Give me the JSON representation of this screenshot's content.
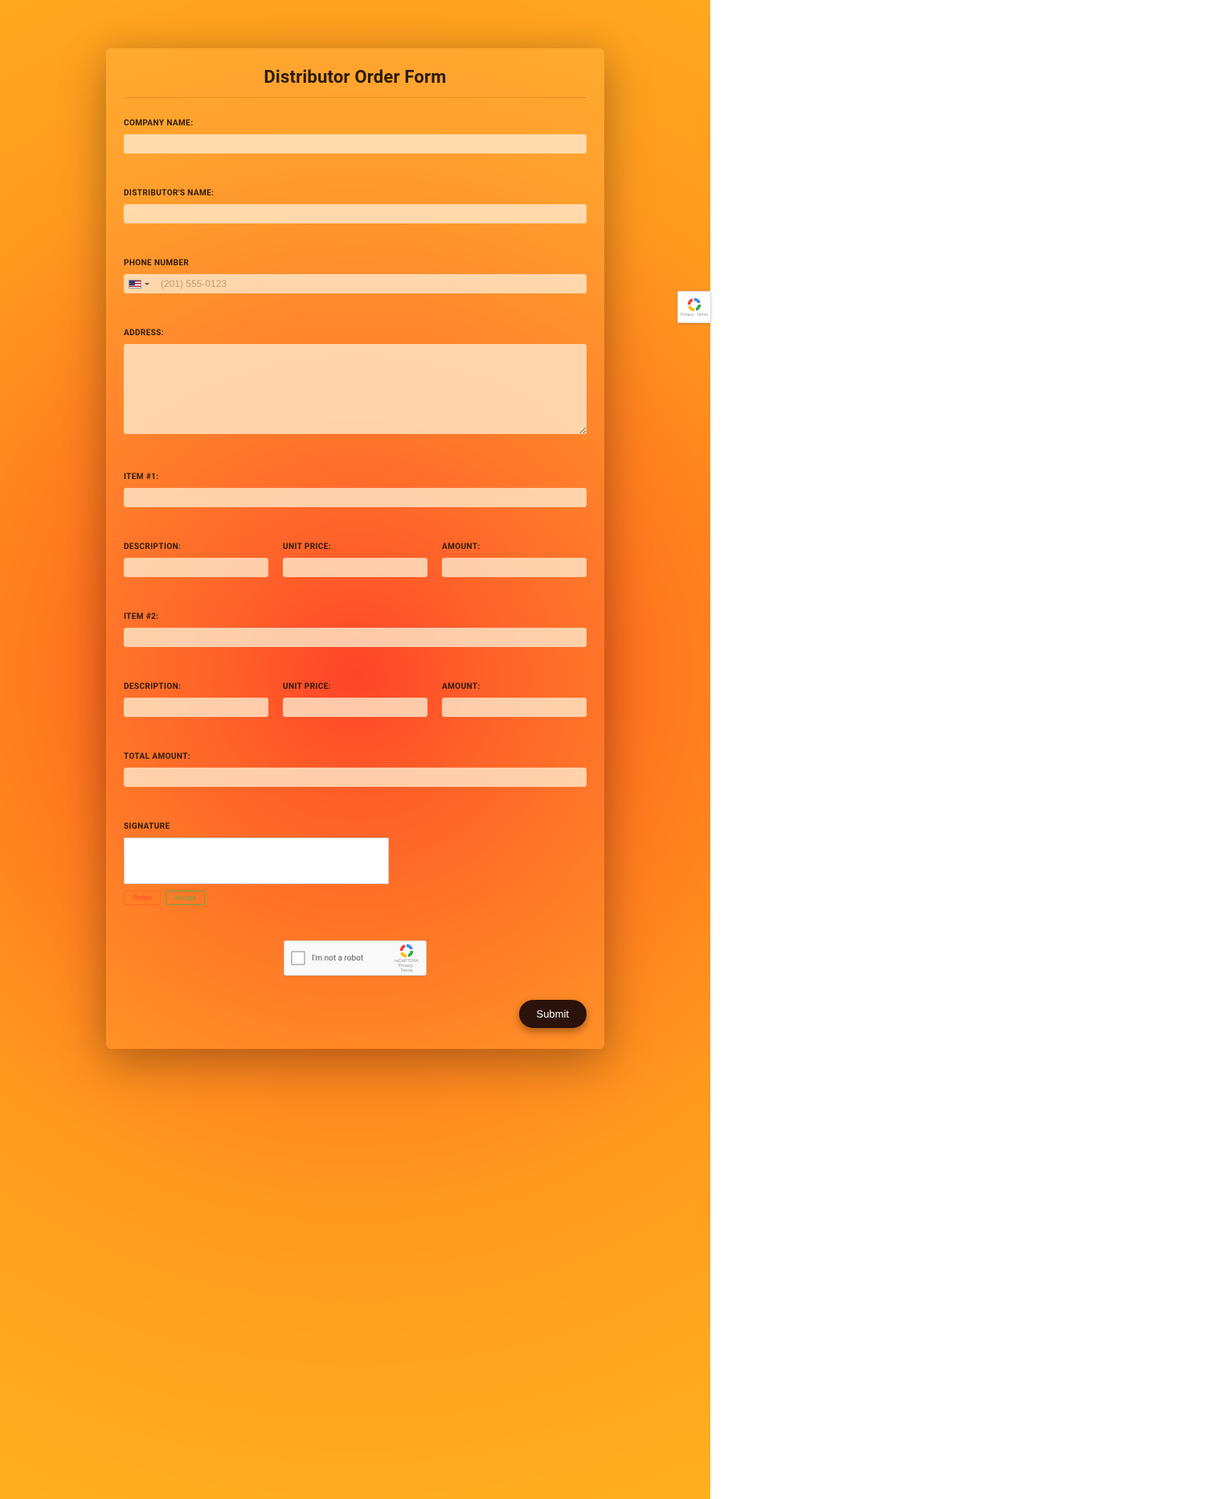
{
  "form": {
    "title": "Distributor Order Form",
    "company_name_label": "COMPANY NAME:",
    "distributor_name_label": "DISTRIBUTOR'S NAME:",
    "phone_label": "PHONE NUMBER",
    "phone_placeholder": "(201) 555-0123",
    "address_label": "ADDRESS:",
    "item1_label": "ITEM #1:",
    "item2_label": "ITEM #2:",
    "description_label": "DESCRIPTION:",
    "unit_price_label": "UNIT PRICE:",
    "amount_label": "AMOUNT:",
    "total_amount_label": "TOTAL AMOUNT:",
    "signature_label": "SIGNATURE",
    "signature_reset": "Reset",
    "signature_accept": "Accept",
    "captcha_text": "I'm not a robot",
    "captcha_brand": "reCAPTCHA",
    "captcha_terms": "Privacy - Terms",
    "submit_label": "Submit"
  }
}
